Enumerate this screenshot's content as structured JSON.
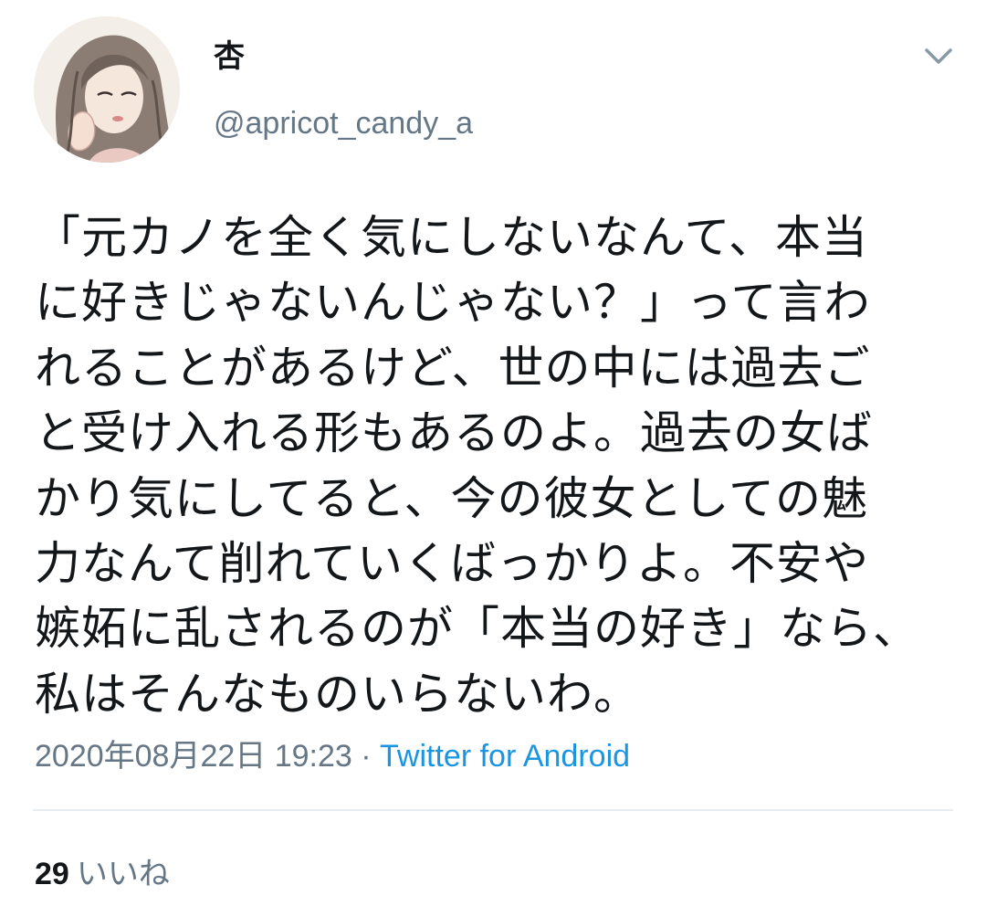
{
  "tweet": {
    "author": {
      "display_name": "杏",
      "handle": "@apricot_candy_a"
    },
    "text_lines": [
      "「元カノを全く気にしないなんて、本当",
      "に好きじゃないんじゃない？」って言わ",
      "れることがあるけど、世の中には過去ご",
      "と受け入れる形もあるのよ。過去の女ば",
      "かり気にしてると、今の彼女としての魅",
      "力なんて削れていくばっかりよ。不安や",
      "嫉妬に乱されるのが「本当の好き」なら、",
      "私はそんなものいらないわ。"
    ],
    "timestamp": "2020年08月22日 19:23",
    "separator": " · ",
    "source": "Twitter for Android",
    "likes_count": "29",
    "likes_label": "いいね"
  },
  "icons": {
    "more": "chevron-down-icon",
    "avatar": "user-avatar"
  },
  "colors": {
    "text": "#14171a",
    "secondary": "#657786",
    "link": "#1b95e0",
    "divider": "#e6ecf0"
  }
}
